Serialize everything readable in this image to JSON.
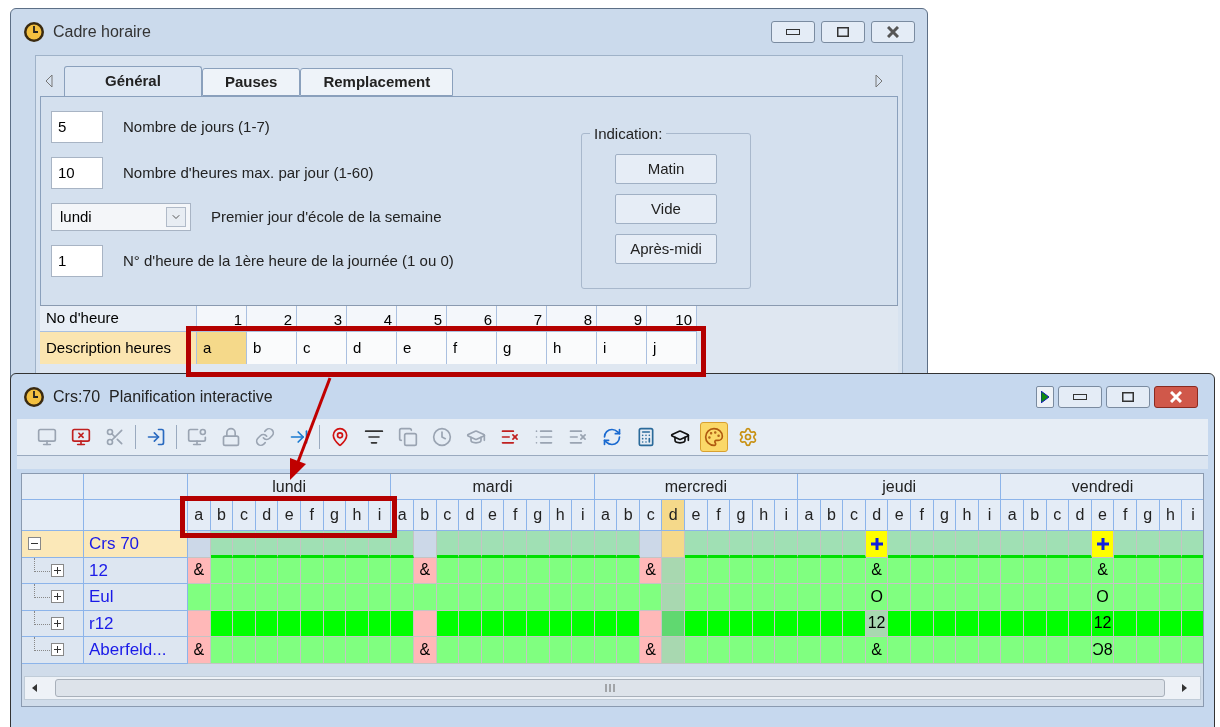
{
  "top_window": {
    "title": "Cadre horaire",
    "tabs": [
      {
        "label": "Général",
        "selected": true
      },
      {
        "label": "Pauses",
        "selected": false
      },
      {
        "label": "Remplacement",
        "selected": false
      }
    ],
    "fields": [
      {
        "kind": "text",
        "value": "5",
        "label": "Nombre de jours (1-7)"
      },
      {
        "kind": "text",
        "value": "10",
        "label": "Nombre d'heures max. par jour (1-60)"
      },
      {
        "kind": "dropdown",
        "value": "lundi",
        "label": "Premier jour d'école de la semaine"
      },
      {
        "kind": "text",
        "value": "1",
        "label": "N° d'heure de la 1ère heure de la journée (1 ou 0)"
      }
    ],
    "indication": {
      "title": "Indication:",
      "buttons": [
        "Matin",
        "Vide",
        "Après-midi"
      ]
    },
    "hours_table": {
      "number_header": "No d'heure",
      "numbers": [
        "1",
        "2",
        "3",
        "4",
        "5",
        "6",
        "7",
        "8",
        "9",
        "10"
      ],
      "description_header": "Description heures",
      "descriptions": [
        {
          "label": "a",
          "selected": true
        },
        {
          "label": "b",
          "selected": false
        },
        {
          "label": "c",
          "selected": false
        },
        {
          "label": "d",
          "selected": false
        },
        {
          "label": "e",
          "selected": false
        },
        {
          "label": "f",
          "selected": false
        },
        {
          "label": "g",
          "selected": false
        },
        {
          "label": "h",
          "selected": false
        },
        {
          "label": "i",
          "selected": false
        },
        {
          "label": "j",
          "selected": false
        }
      ]
    }
  },
  "bottom_window": {
    "title": "Crs:70  Planification interactive",
    "toolbar": [
      {
        "kind": "button",
        "disabled": true,
        "pressed": false
      },
      {
        "kind": "button",
        "disabled": false,
        "pressed": false
      },
      {
        "kind": "button",
        "disabled": true,
        "pressed": false
      },
      {
        "kind": "separator"
      },
      {
        "kind": "button",
        "disabled": false,
        "pressed": false
      },
      {
        "kind": "separator"
      },
      {
        "kind": "button",
        "disabled": true,
        "pressed": false
      },
      {
        "kind": "button",
        "disabled": true,
        "pressed": false
      },
      {
        "kind": "button",
        "disabled": true,
        "pressed": false
      },
      {
        "kind": "button",
        "disabled": false,
        "pressed": false
      },
      {
        "kind": "separator"
      },
      {
        "kind": "button",
        "disabled": false,
        "pressed": false
      },
      {
        "kind": "button",
        "disabled": false,
        "pressed": false
      },
      {
        "kind": "button",
        "disabled": true,
        "pressed": false
      },
      {
        "kind": "button",
        "disabled": true,
        "pressed": false
      },
      {
        "kind": "button",
        "disabled": true,
        "pressed": false
      },
      {
        "kind": "button",
        "disabled": false,
        "pressed": false
      },
      {
        "kind": "button",
        "disabled": true,
        "pressed": false
      },
      {
        "kind": "button",
        "disabled": true,
        "pressed": false
      },
      {
        "kind": "button",
        "disabled": false,
        "pressed": false
      },
      {
        "kind": "button",
        "disabled": false,
        "pressed": false
      },
      {
        "kind": "button",
        "disabled": false,
        "pressed": false
      },
      {
        "kind": "button",
        "disabled": false,
        "pressed": true
      },
      {
        "kind": "button",
        "disabled": false,
        "pressed": false
      }
    ],
    "days": [
      {
        "name": "lundi",
        "periods": [
          {
            "label": "a",
            "selected": false
          },
          {
            "label": "b",
            "selected": false
          },
          {
            "label": "c",
            "selected": false
          },
          {
            "label": "d",
            "selected": false
          },
          {
            "label": "e",
            "selected": false
          },
          {
            "label": "f",
            "selected": false
          },
          {
            "label": "g",
            "selected": false
          },
          {
            "label": "h",
            "selected": false
          },
          {
            "label": "i",
            "selected": false
          }
        ]
      },
      {
        "name": "mardi",
        "periods": [
          {
            "label": "a",
            "selected": false
          },
          {
            "label": "b",
            "selected": false
          },
          {
            "label": "c",
            "selected": false
          },
          {
            "label": "d",
            "selected": false
          },
          {
            "label": "e",
            "selected": false
          },
          {
            "label": "f",
            "selected": false
          },
          {
            "label": "g",
            "selected": false
          },
          {
            "label": "h",
            "selected": false
          },
          {
            "label": "i",
            "selected": false
          }
        ]
      },
      {
        "name": "mercredi",
        "periods": [
          {
            "label": "a",
            "selected": false
          },
          {
            "label": "b",
            "selected": false
          },
          {
            "label": "c",
            "selected": false
          },
          {
            "label": "d",
            "selected": true
          },
          {
            "label": "e",
            "selected": false
          },
          {
            "label": "f",
            "selected": false
          },
          {
            "label": "g",
            "selected": false
          },
          {
            "label": "h",
            "selected": false
          },
          {
            "label": "i",
            "selected": false
          }
        ]
      },
      {
        "name": "jeudi",
        "periods": [
          {
            "label": "a",
            "selected": false
          },
          {
            "label": "b",
            "selected": false
          },
          {
            "label": "c",
            "selected": false
          },
          {
            "label": "d",
            "selected": false
          },
          {
            "label": "e",
            "selected": false
          },
          {
            "label": "f",
            "selected": false
          },
          {
            "label": "g",
            "selected": false
          },
          {
            "label": "h",
            "selected": false
          },
          {
            "label": "i",
            "selected": false
          }
        ]
      },
      {
        "name": "vendredi",
        "periods": [
          {
            "label": "a",
            "selected": false
          },
          {
            "label": "b",
            "selected": false
          },
          {
            "label": "c",
            "selected": false
          },
          {
            "label": "d",
            "selected": false
          },
          {
            "label": "e",
            "selected": false
          },
          {
            "label": "f",
            "selected": false
          },
          {
            "label": "g",
            "selected": false
          },
          {
            "label": "h",
            "selected": false
          },
          {
            "label": "i",
            "selected": false
          }
        ]
      }
    ],
    "tree": {
      "label": "Crs 70",
      "expanded": true,
      "selected": true,
      "cells": [
        {
          "kind": "empty"
        },
        {
          "kind": "head"
        },
        {
          "kind": "head"
        },
        {
          "kind": "head"
        },
        {
          "kind": "head"
        },
        {
          "kind": "head"
        },
        {
          "kind": "head"
        },
        {
          "kind": "head"
        },
        {
          "kind": "head"
        },
        {
          "kind": "head"
        },
        {
          "kind": "empty"
        },
        {
          "kind": "head"
        },
        {
          "kind": "head"
        },
        {
          "kind": "head"
        },
        {
          "kind": "head"
        },
        {
          "kind": "head"
        },
        {
          "kind": "head"
        },
        {
          "kind": "head"
        },
        {
          "kind": "head"
        },
        {
          "kind": "head"
        },
        {
          "kind": "empty"
        },
        {
          "kind": "sel"
        },
        {
          "kind": "head"
        },
        {
          "kind": "head"
        },
        {
          "kind": "head"
        },
        {
          "kind": "head"
        },
        {
          "kind": "head"
        },
        {
          "kind": "head"
        },
        {
          "kind": "head"
        },
        {
          "kind": "head"
        },
        {
          "kind": "plus"
        },
        {
          "kind": "head"
        },
        {
          "kind": "head"
        },
        {
          "kind": "head"
        },
        {
          "kind": "head"
        },
        {
          "kind": "head"
        },
        {
          "kind": "head"
        },
        {
          "kind": "head"
        },
        {
          "kind": "head"
        },
        {
          "kind": "head"
        },
        {
          "kind": "plus"
        },
        {
          "kind": "head"
        },
        {
          "kind": "head"
        },
        {
          "kind": "head"
        },
        {
          "kind": "head"
        }
      ],
      "children": [
        {
          "label": "12",
          "expanded": false,
          "selected": false,
          "cells": [
            {
              "kind": "blocked",
              "text": "&"
            },
            {
              "kind": "free"
            },
            {
              "kind": "free"
            },
            {
              "kind": "free"
            },
            {
              "kind": "free"
            },
            {
              "kind": "free"
            },
            {
              "kind": "free"
            },
            {
              "kind": "free"
            },
            {
              "kind": "free"
            },
            {
              "kind": "free"
            },
            {
              "kind": "blocked",
              "text": "&"
            },
            {
              "kind": "free"
            },
            {
              "kind": "free"
            },
            {
              "kind": "free"
            },
            {
              "kind": "free"
            },
            {
              "kind": "free"
            },
            {
              "kind": "free"
            },
            {
              "kind": "free"
            },
            {
              "kind": "free"
            },
            {
              "kind": "free"
            },
            {
              "kind": "blocked",
              "text": "&"
            },
            {
              "kind": "dim"
            },
            {
              "kind": "free"
            },
            {
              "kind": "free"
            },
            {
              "kind": "free"
            },
            {
              "kind": "free"
            },
            {
              "kind": "free"
            },
            {
              "kind": "free"
            },
            {
              "kind": "free"
            },
            {
              "kind": "free"
            },
            {
              "kind": "free",
              "text": "&"
            },
            {
              "kind": "free"
            },
            {
              "kind": "free"
            },
            {
              "kind": "free"
            },
            {
              "kind": "free"
            },
            {
              "kind": "free"
            },
            {
              "kind": "free"
            },
            {
              "kind": "free"
            },
            {
              "kind": "free"
            },
            {
              "kind": "free"
            },
            {
              "kind": "free",
              "text": "&"
            },
            {
              "kind": "free"
            },
            {
              "kind": "free"
            },
            {
              "kind": "free"
            },
            {
              "kind": "free"
            }
          ]
        },
        {
          "label": "Eul",
          "expanded": false,
          "selected": false,
          "cells": [
            {
              "kind": "free"
            },
            {
              "kind": "free"
            },
            {
              "kind": "free"
            },
            {
              "kind": "free"
            },
            {
              "kind": "free"
            },
            {
              "kind": "free"
            },
            {
              "kind": "free"
            },
            {
              "kind": "free"
            },
            {
              "kind": "free"
            },
            {
              "kind": "free"
            },
            {
              "kind": "free"
            },
            {
              "kind": "free"
            },
            {
              "kind": "free"
            },
            {
              "kind": "free"
            },
            {
              "kind": "free"
            },
            {
              "kind": "free"
            },
            {
              "kind": "free"
            },
            {
              "kind": "free"
            },
            {
              "kind": "free"
            },
            {
              "kind": "free"
            },
            {
              "kind": "free"
            },
            {
              "kind": "dim"
            },
            {
              "kind": "free"
            },
            {
              "kind": "free"
            },
            {
              "kind": "free"
            },
            {
              "kind": "free"
            },
            {
              "kind": "free"
            },
            {
              "kind": "free"
            },
            {
              "kind": "free"
            },
            {
              "kind": "free"
            },
            {
              "kind": "free",
              "text": "O"
            },
            {
              "kind": "free"
            },
            {
              "kind": "free"
            },
            {
              "kind": "free"
            },
            {
              "kind": "free"
            },
            {
              "kind": "free"
            },
            {
              "kind": "free"
            },
            {
              "kind": "free"
            },
            {
              "kind": "free"
            },
            {
              "kind": "free"
            },
            {
              "kind": "free",
              "text": "O"
            },
            {
              "kind": "free"
            },
            {
              "kind": "free"
            },
            {
              "kind": "free"
            },
            {
              "kind": "free"
            }
          ]
        },
        {
          "label": "r12",
          "expanded": false,
          "selected": false,
          "cells": [
            {
              "kind": "blocked"
            },
            {
              "kind": "busy"
            },
            {
              "kind": "busy"
            },
            {
              "kind": "busy"
            },
            {
              "kind": "busy"
            },
            {
              "kind": "busy"
            },
            {
              "kind": "busy"
            },
            {
              "kind": "busy"
            },
            {
              "kind": "busy"
            },
            {
              "kind": "busy"
            },
            {
              "kind": "blocked"
            },
            {
              "kind": "busy"
            },
            {
              "kind": "busy"
            },
            {
              "kind": "busy"
            },
            {
              "kind": "busy"
            },
            {
              "kind": "busy"
            },
            {
              "kind": "busy"
            },
            {
              "kind": "busy"
            },
            {
              "kind": "busy"
            },
            {
              "kind": "busy"
            },
            {
              "kind": "blocked"
            },
            {
              "kind": "busydim"
            },
            {
              "kind": "busy"
            },
            {
              "kind": "busy"
            },
            {
              "kind": "busy"
            },
            {
              "kind": "busy"
            },
            {
              "kind": "busy"
            },
            {
              "kind": "busy"
            },
            {
              "kind": "busy"
            },
            {
              "kind": "busy"
            },
            {
              "kind": "dim",
              "text": "12"
            },
            {
              "kind": "busy"
            },
            {
              "kind": "busy"
            },
            {
              "kind": "busy"
            },
            {
              "kind": "busy"
            },
            {
              "kind": "busy"
            },
            {
              "kind": "busy"
            },
            {
              "kind": "busy"
            },
            {
              "kind": "busy"
            },
            {
              "kind": "busy"
            },
            {
              "kind": "busy",
              "text": "12"
            },
            {
              "kind": "busy"
            },
            {
              "kind": "busy"
            },
            {
              "kind": "busy"
            },
            {
              "kind": "busy"
            }
          ]
        },
        {
          "label": "Aberfeld...",
          "expanded": false,
          "selected": false,
          "cells": [
            {
              "kind": "blocked",
              "text": "&"
            },
            {
              "kind": "free"
            },
            {
              "kind": "free"
            },
            {
              "kind": "free"
            },
            {
              "kind": "free"
            },
            {
              "kind": "free"
            },
            {
              "kind": "free"
            },
            {
              "kind": "free"
            },
            {
              "kind": "free"
            },
            {
              "kind": "free"
            },
            {
              "kind": "blocked",
              "text": "&"
            },
            {
              "kind": "free"
            },
            {
              "kind": "free"
            },
            {
              "kind": "free"
            },
            {
              "kind": "free"
            },
            {
              "kind": "free"
            },
            {
              "kind": "free"
            },
            {
              "kind": "free"
            },
            {
              "kind": "free"
            },
            {
              "kind": "free"
            },
            {
              "kind": "blocked",
              "text": "&"
            },
            {
              "kind": "dim"
            },
            {
              "kind": "free"
            },
            {
              "kind": "free"
            },
            {
              "kind": "free"
            },
            {
              "kind": "free"
            },
            {
              "kind": "free"
            },
            {
              "kind": "free"
            },
            {
              "kind": "free"
            },
            {
              "kind": "free"
            },
            {
              "kind": "free",
              "text": "&"
            },
            {
              "kind": "free"
            },
            {
              "kind": "free"
            },
            {
              "kind": "free"
            },
            {
              "kind": "free"
            },
            {
              "kind": "free"
            },
            {
              "kind": "free"
            },
            {
              "kind": "free"
            },
            {
              "kind": "free"
            },
            {
              "kind": "free"
            },
            {
              "kind": "free",
              "text": "Ɔ8"
            },
            {
              "kind": "free"
            },
            {
              "kind": "free"
            },
            {
              "kind": "free"
            },
            {
              "kind": "free"
            }
          ]
        }
      ]
    }
  },
  "callouts": [
    {
      "kind": "box"
    },
    {
      "kind": "box"
    },
    {
      "kind": "arrow"
    }
  ]
}
